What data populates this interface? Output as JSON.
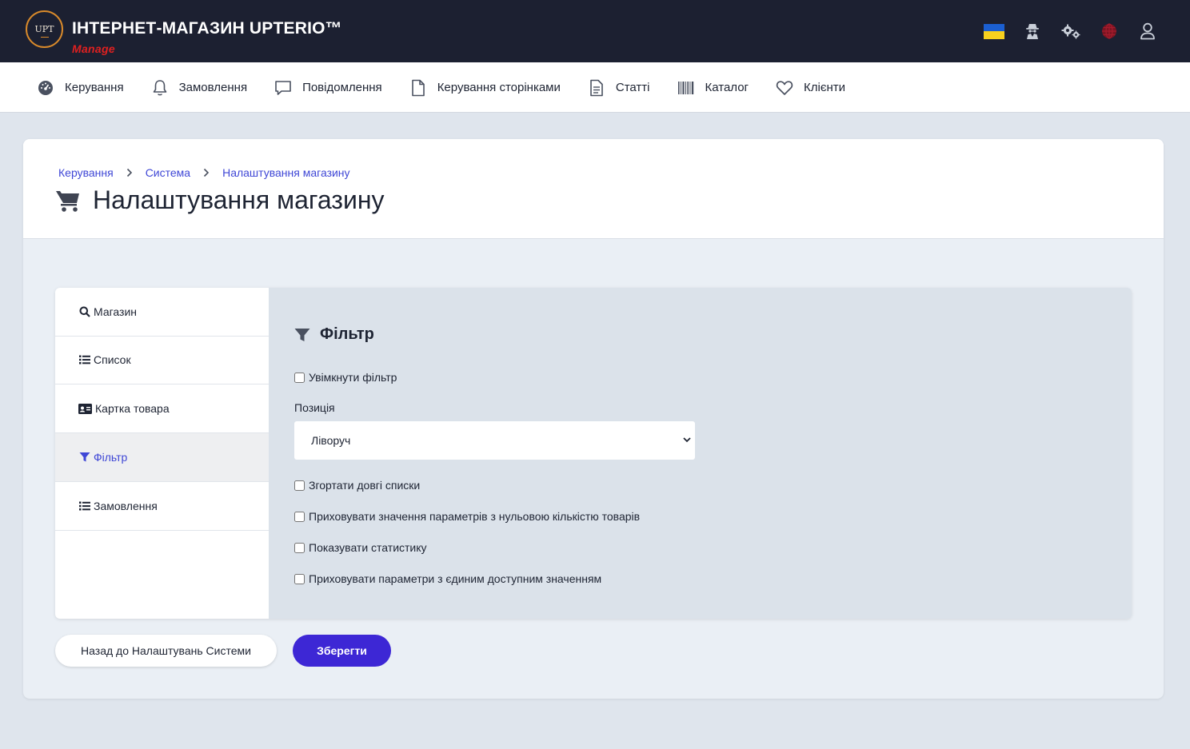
{
  "header": {
    "logo_text": "UPT",
    "title": "ІНТЕРНЕТ-МАГАЗИН UPTERIO™",
    "subtitle": "Manage",
    "icons": [
      "ukraine-flag-icon",
      "user-secret-icon",
      "gears-icon",
      "globe-icon",
      "user-icon"
    ]
  },
  "nav": {
    "items": [
      {
        "label": "Керування",
        "icon": "dashboard-icon"
      },
      {
        "label": "Замовлення",
        "icon": "bell-icon"
      },
      {
        "label": "Повідомлення",
        "icon": "comment-icon"
      },
      {
        "label": "Керування сторінками",
        "icon": "file-icon"
      },
      {
        "label": "Статті",
        "icon": "file-text-icon"
      },
      {
        "label": "Каталог",
        "icon": "barcode-icon"
      },
      {
        "label": "Клієнти",
        "icon": "heart-icon"
      }
    ]
  },
  "breadcrumb": {
    "items": [
      "Керування",
      "Система",
      "Налаштування магазину"
    ]
  },
  "page": {
    "title": "Налаштування магазину",
    "icon": "cart-icon"
  },
  "sidebar": {
    "items": [
      {
        "label": "Магазин",
        "icon": "search-icon",
        "active": false
      },
      {
        "label": "Список",
        "icon": "list-icon",
        "active": false
      },
      {
        "label": "Картка товара",
        "icon": "id-card-icon",
        "active": false
      },
      {
        "label": "Фільтр",
        "icon": "filter-icon",
        "active": true
      },
      {
        "label": "Замовлення",
        "icon": "list-icon",
        "active": false
      }
    ]
  },
  "filter": {
    "title": "Фільтр",
    "enable_filter": {
      "label": "Увімкнути фільтр",
      "checked": false
    },
    "position": {
      "label": "Позиція",
      "value": "Ліворуч"
    },
    "options": [
      {
        "label": "Згортати довгі списки",
        "checked": false
      },
      {
        "label": "Приховувати значення параметрів з нульовою кількістю товарів",
        "checked": false
      },
      {
        "label": "Показувати статистику",
        "checked": false
      },
      {
        "label": "Приховувати параметри з єдиним доступним значенням",
        "checked": false
      }
    ]
  },
  "buttons": {
    "back_label": "Назад до Налаштувань Системи",
    "save_label": "Зберегти"
  },
  "colors": {
    "header_bg": "#1c2031",
    "accent": "#3f47d6",
    "save_button": "#3d27d5",
    "brand_sub": "#e02020",
    "logo_ring": "#d98a2b"
  }
}
